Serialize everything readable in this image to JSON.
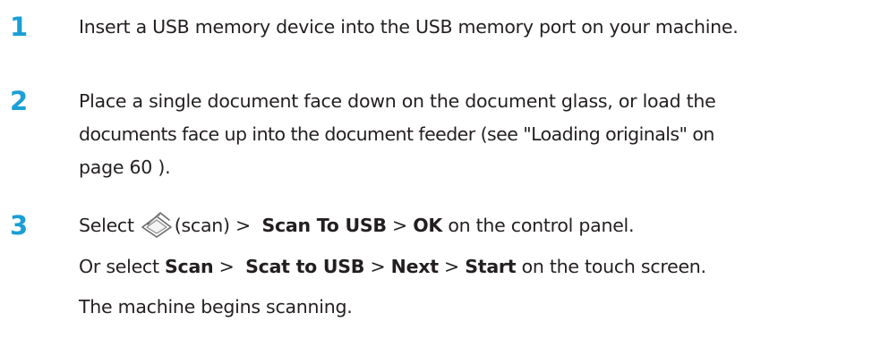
{
  "steps": [
    {
      "number": "1",
      "text": "Insert a USB memory device into the USB memory port on your machine."
    },
    {
      "number": "2",
      "lines": [
        "Place a single document face down on the document glass, or load the",
        "documents face up into the document feeder (see \"Loading originals\" on",
        "page 60 )."
      ]
    },
    {
      "number": "3",
      "line1": {
        "prefix": "Select",
        "icon": "scan-icon",
        "icon_label": "(scan) >",
        "scan_to_usb": "Scan To USB",
        "sep1": ">",
        "ok": "OK",
        "suffix": "on the control panel."
      },
      "line2": {
        "prefix": "Or select",
        "scan": "Scan",
        "sep1": ">",
        "scat_to_usb": "Scat to USB",
        "sep2": ">",
        "next": "Next",
        "sep3": ">",
        "start": "Start",
        "suffix": "on the touch screen."
      },
      "line3": "The machine begins scanning."
    }
  ]
}
